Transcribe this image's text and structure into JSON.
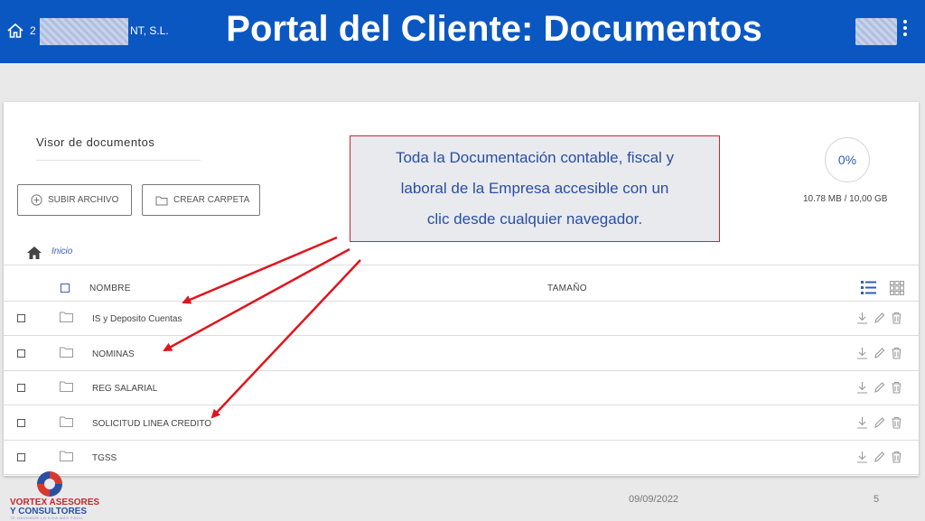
{
  "header": {
    "company_prefix": "2",
    "company_suffix": "NT, S.L.",
    "title": "Portal del Cliente: Documentos"
  },
  "viewer": {
    "title": "Visor de documentos",
    "upload_label": "SUBIR ARCHIVO",
    "create_folder_label": "CREAR CARPETA"
  },
  "storage": {
    "percent": "0%",
    "usage": "10.78 MB / 10,00 GB"
  },
  "callout": {
    "line1": "Toda la Documentación contable, fiscal y",
    "line2": "laboral  de la Empresa accesible con un",
    "line3": "clic desde cualquier navegador."
  },
  "breadcrumb": {
    "home_label": "Inicio"
  },
  "table": {
    "columns": [
      "NOMBRE",
      "TAMAÑO"
    ],
    "rows": [
      {
        "name": "IS y Deposito Cuentas"
      },
      {
        "name": "NOMINAS"
      },
      {
        "name": "REG SALARIAL"
      },
      {
        "name": "SOLICITUD LINEA CREDITO"
      },
      {
        "name": "TGSS"
      }
    ]
  },
  "footer": {
    "brand_line1": "VORTEX ASESORES",
    "brand_line2": "Y CONSULTORES",
    "brand_tagline": "TE HACEMOS LA VIDA MÁS FÁCIL",
    "date": "09/09/2022",
    "page": "5"
  },
  "colors": {
    "header_bg": "#0b57c2",
    "accent": "#2c5db9",
    "arrow": "#e0141c"
  }
}
